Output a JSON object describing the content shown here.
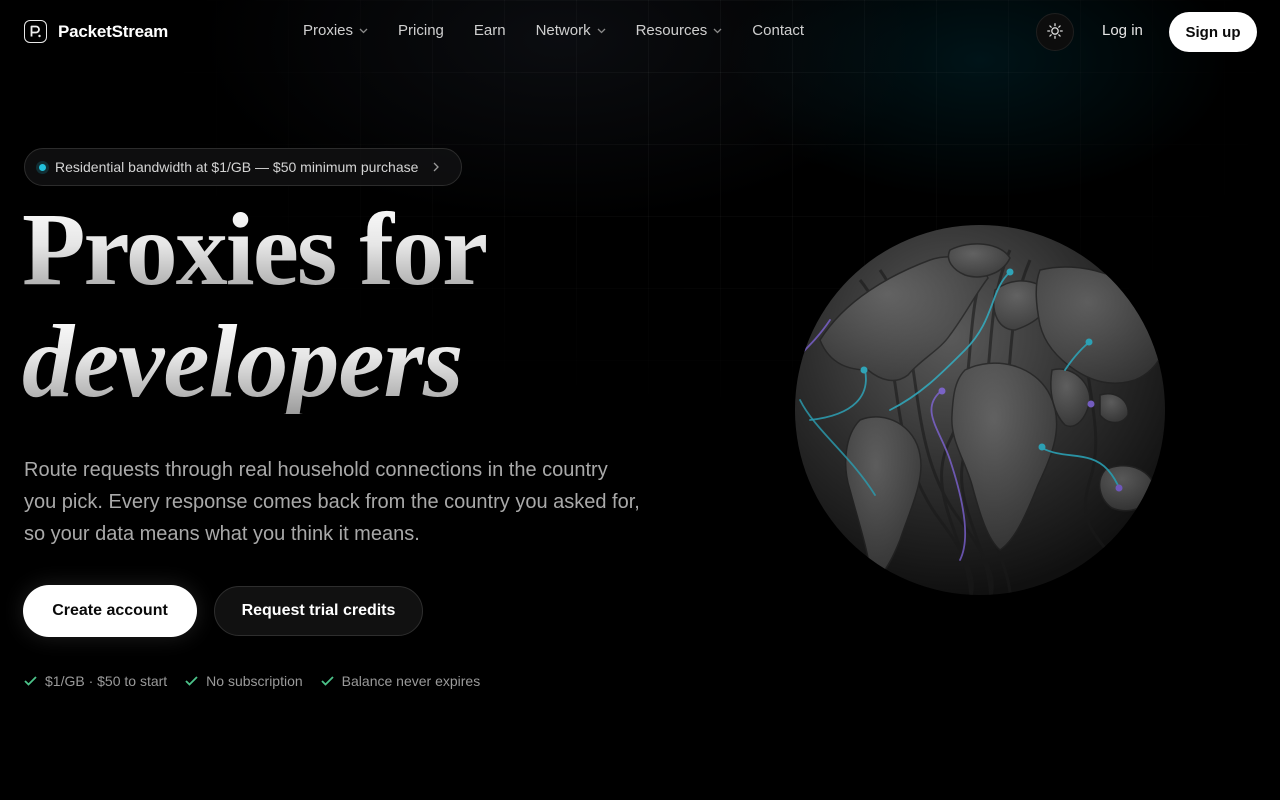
{
  "brand": {
    "name": "PacketStream",
    "logo_letter": "P"
  },
  "nav": {
    "links": [
      {
        "label": "Proxies",
        "has_dropdown": true
      },
      {
        "label": "Pricing",
        "has_dropdown": false
      },
      {
        "label": "Earn",
        "has_dropdown": false
      },
      {
        "label": "Network",
        "has_dropdown": true
      },
      {
        "label": "Resources",
        "has_dropdown": true
      },
      {
        "label": "Contact",
        "has_dropdown": false
      }
    ],
    "theme_toggle_icon": "sun-icon",
    "login_label": "Log in",
    "signup_label": "Sign up"
  },
  "hero": {
    "announcement": "Residential bandwidth at $1/GB — $50 minimum purchase",
    "headline_line1": "Proxies for",
    "headline_line2": "developers",
    "subtitle": "Route requests through real household connections in the country you pick. Every response comes back from the country you asked for, so your data means what you think it means.",
    "primary_cta": "Create account",
    "secondary_cta": "Request trial credits",
    "checks": [
      "$1/GB · $50 to start",
      "No subscription",
      "Balance never expires"
    ]
  },
  "colors": {
    "background": "#000000",
    "accent_cyan": "#22c2dd",
    "accent_purple": "#8b6cf0",
    "check_green": "#4cc38a",
    "text_muted": "#a9a9a9"
  }
}
